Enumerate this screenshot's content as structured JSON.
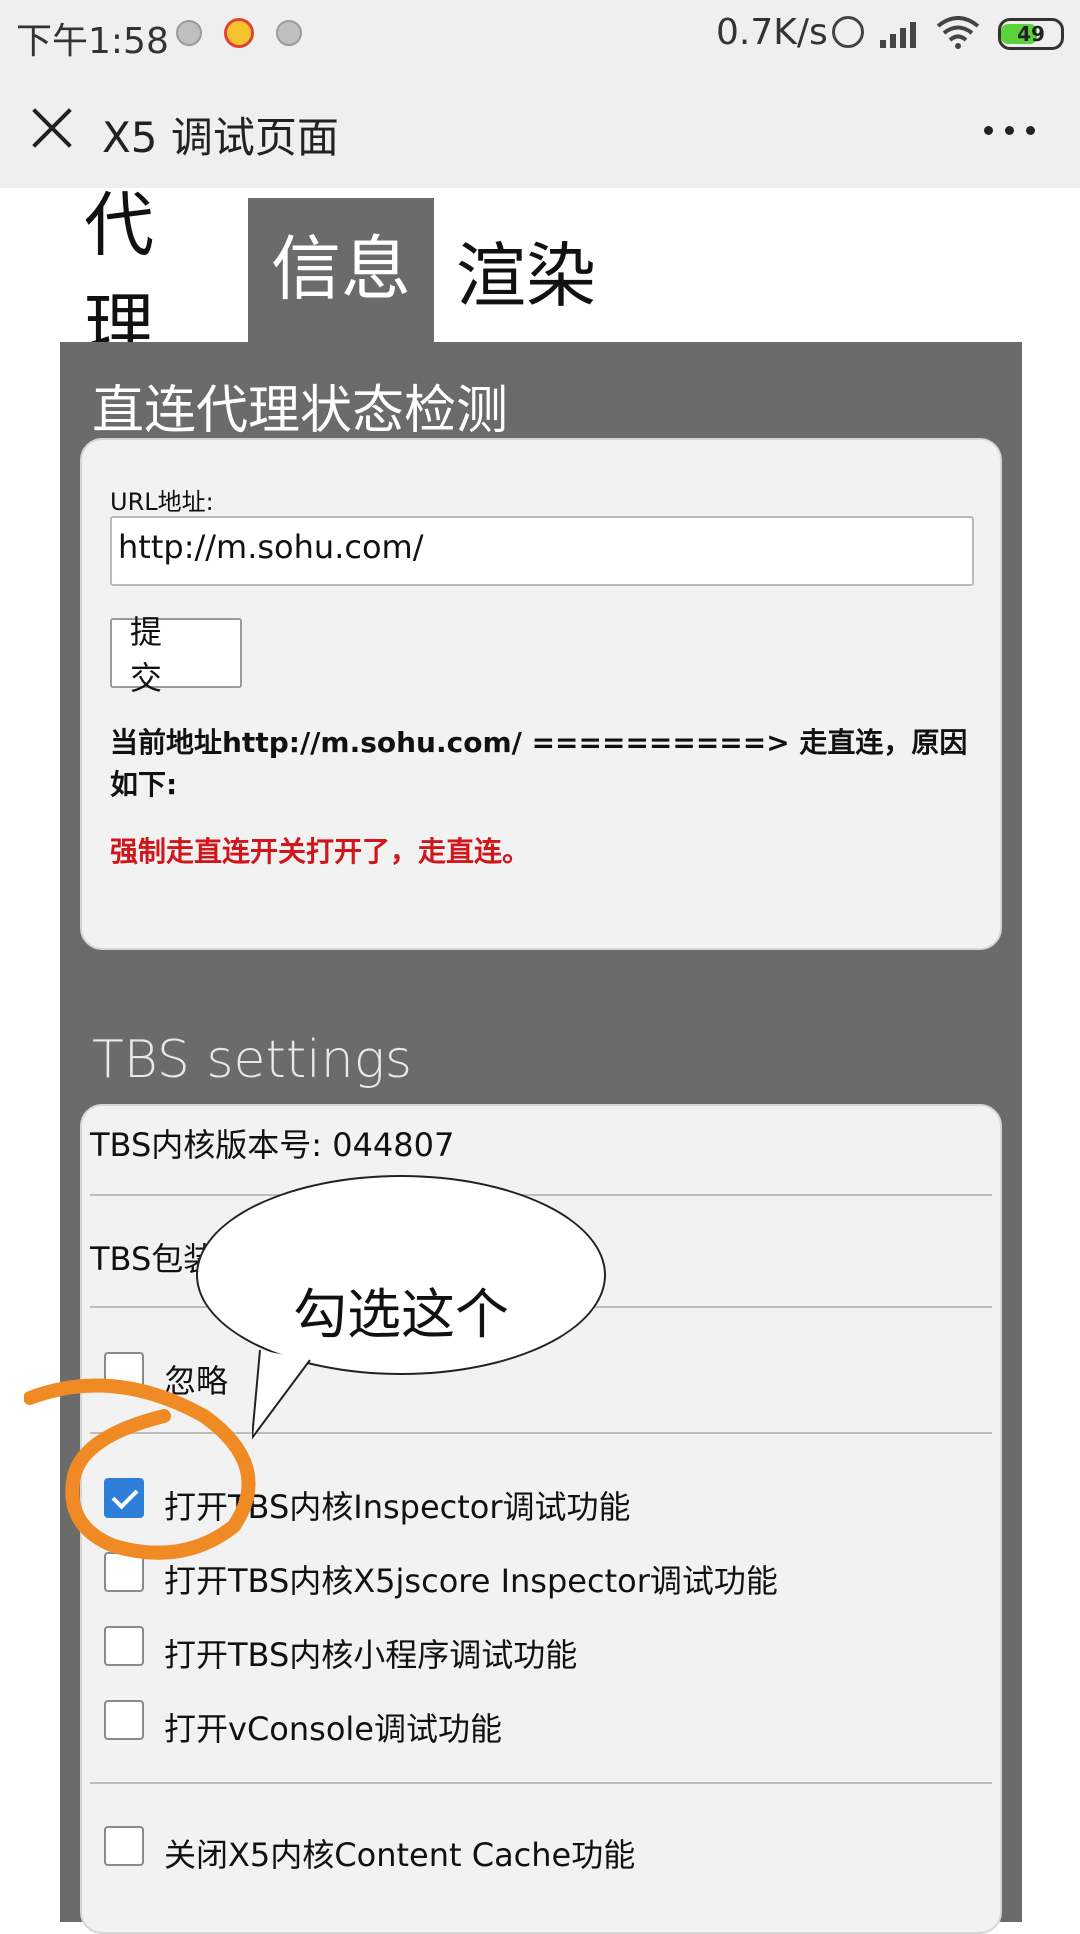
{
  "status_bar": {
    "time": "下午1:58",
    "speed": "0.7K/s",
    "battery": "49"
  },
  "app_bar": {
    "title": "X5 调试页面"
  },
  "tabs": [
    {
      "label": "代理",
      "active": false
    },
    {
      "label": "信息",
      "active": true
    },
    {
      "label": "渲染",
      "active": false
    }
  ],
  "proxy_section": {
    "title": "直连代理状态检测",
    "url_label": "URL地址:",
    "url_value": "http://m.sohu.com/",
    "submit_label": "提 交",
    "status_text": "当前地址http://m.sohu.com/ ==========> 走直连，原因如下:",
    "reason_text": "强制走直连开关打开了，走直连。"
  },
  "tbs_section": {
    "title": "TBS settings",
    "core_version": "TBS内核版本号: 044807",
    "package_row": "TBS包装",
    "options": [
      {
        "label": "忽略",
        "checked": false
      },
      {
        "label": "打开TBS内核Inspector调试功能",
        "checked": true
      },
      {
        "label": "打开TBS内核X5jscore Inspector调试功能",
        "checked": false
      },
      {
        "label": "打开TBS内核小程序调试功能",
        "checked": false
      },
      {
        "label": "打开vConsole调试功能",
        "checked": false
      },
      {
        "label": "关闭X5内核Content Cache功能",
        "checked": false
      }
    ]
  },
  "annotation": {
    "bubble_text": "勾选这个"
  },
  "colors": {
    "panel": "#6b6b6b",
    "reason": "#d0161b",
    "checkbox_checked": "#2e7fd8",
    "annotation_stroke": "#f08a24"
  }
}
